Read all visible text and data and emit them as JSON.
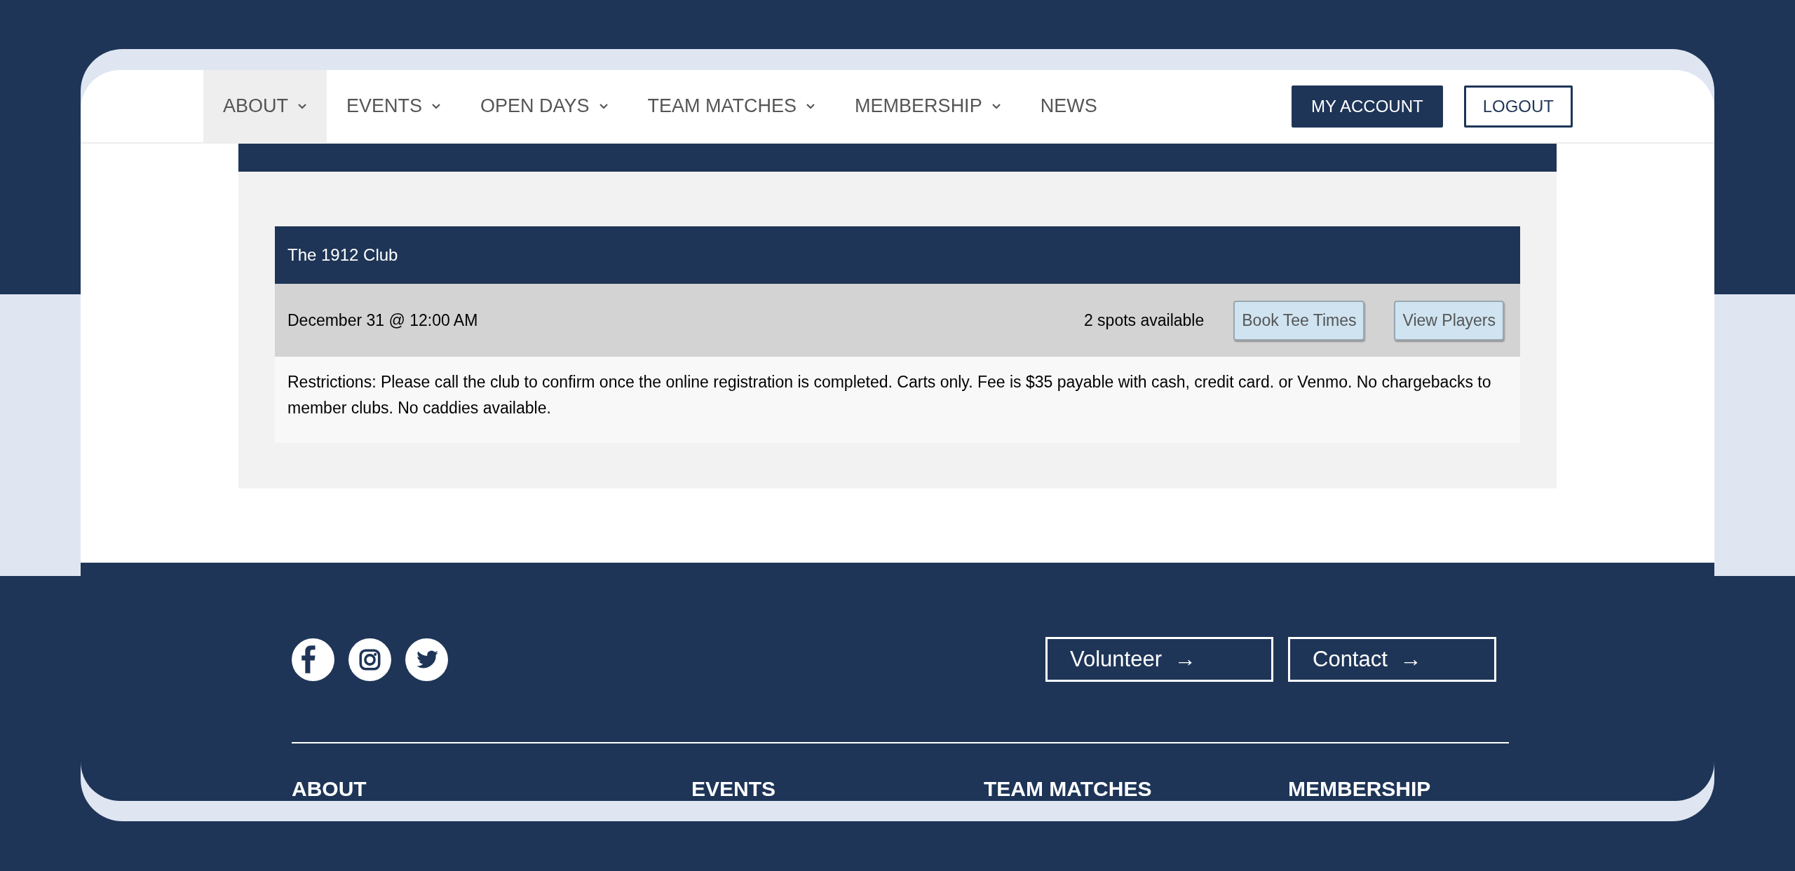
{
  "nav": {
    "items": [
      {
        "label": "ABOUT",
        "has_dropdown": true,
        "hovered": true
      },
      {
        "label": "EVENTS",
        "has_dropdown": true,
        "hovered": false
      },
      {
        "label": "OPEN DAYS",
        "has_dropdown": true,
        "hovered": false
      },
      {
        "label": "TEAM MATCHES",
        "has_dropdown": true,
        "hovered": false
      },
      {
        "label": "MEMBERSHIP",
        "has_dropdown": true,
        "hovered": false
      },
      {
        "label": "NEWS",
        "has_dropdown": false,
        "hovered": false
      }
    ],
    "buttons": [
      {
        "label": "MY ACCOUNT",
        "kind": "filled"
      },
      {
        "label": "LOGOUT",
        "kind": "outline"
      }
    ]
  },
  "event": {
    "title": "The 1912 Club",
    "date": "December 31 @ 12:00 AM",
    "spots": "2 spots available",
    "buttons": [
      "Book Tee Times",
      "View Players"
    ],
    "restrictions": "Restrictions: Please call the club to confirm once the online registration is completed. Carts only. Fee is $35 payable with cash, credit card. or Venmo. No chargebacks to member clubs. No caddies available."
  },
  "footer": {
    "social": [
      {
        "kind": "facebook"
      },
      {
        "kind": "instagram"
      },
      {
        "kind": "twitter"
      }
    ],
    "links": [
      {
        "label": "Volunteer",
        "arrow": "→"
      },
      {
        "label": "Contact",
        "arrow": "→"
      }
    ],
    "headings": [
      "ABOUT",
      "EVENTS",
      "TEAM MATCHES",
      "MEMBERSHIP"
    ]
  }
}
